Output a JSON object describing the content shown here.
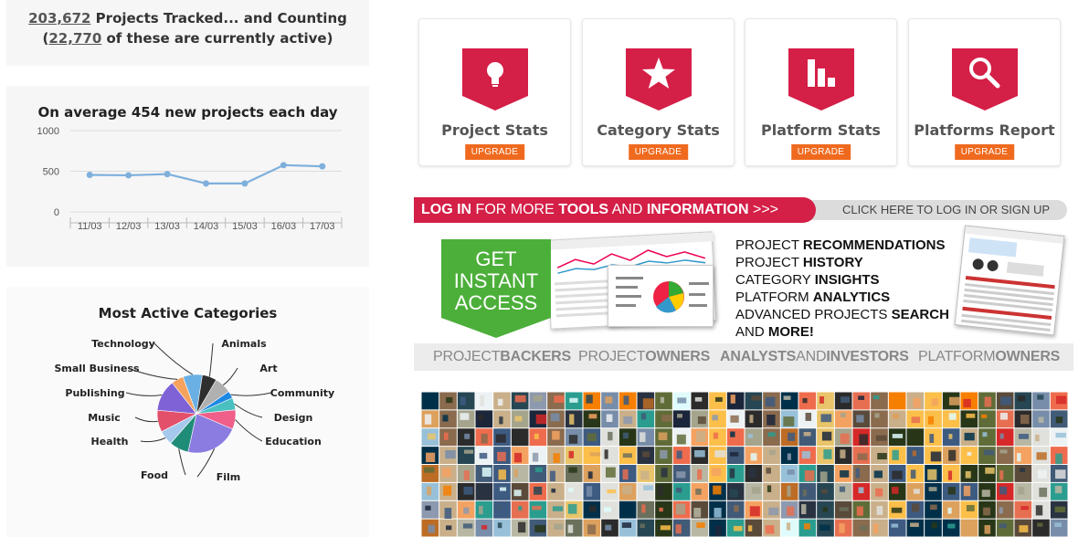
{
  "counter": {
    "tracked_count": "203,672",
    "tracked_text": " Projects Tracked... and Counting",
    "open_paren": "(",
    "active_count": "22,770",
    "active_text": " of these are currently active)"
  },
  "daily": {
    "title": "On average 454 new projects each day"
  },
  "categories_panel": {
    "title": "Most Active Categories"
  },
  "chart_data": [
    {
      "type": "line",
      "title": "On average 454 new projects each day",
      "x": [
        "11/03",
        "12/03",
        "13/03",
        "14/03",
        "15/03",
        "16/03",
        "17/03"
      ],
      "series": [
        {
          "values": [
            455,
            450,
            465,
            350,
            350,
            575,
            560
          ]
        }
      ],
      "yticks": [
        0,
        500,
        1000
      ],
      "ylim": [
        0,
        1000
      ],
      "grid": true,
      "color": "#7fb0dc"
    },
    {
      "type": "pie",
      "title": "Most Active Categories",
      "categories": [
        "Technology",
        "Animals",
        "Art",
        "Community",
        "Design",
        "Education",
        "Film",
        "Food",
        "Health",
        "Music",
        "Publishing",
        "Small Business"
      ],
      "values": [
        8,
        6,
        7,
        3,
        5,
        8,
        22,
        8,
        6,
        9,
        13,
        5
      ],
      "colors": [
        "#6ab0e4",
        "#2e2e2e",
        "#b0b0b0",
        "#1e88e5",
        "#4bc0c0",
        "#ef5f8a",
        "#8a7ce0",
        "#1f8c77",
        "#a5c8ec",
        "#e2506a",
        "#7e62d6",
        "#f5a25d"
      ]
    }
  ],
  "tools": [
    {
      "title": "Project Stats",
      "cta": "UPGRADE",
      "icon": "lightbulb-icon"
    },
    {
      "title": "Category Stats",
      "cta": "UPGRADE",
      "icon": "star-icon"
    },
    {
      "title": "Platform Stats",
      "cta": "UPGRADE",
      "icon": "bar-chart-icon"
    },
    {
      "title": "Platforms Report",
      "cta": "UPGRADE",
      "icon": "magnifier-icon"
    }
  ],
  "login": {
    "w1": "LOG IN",
    "w2": " FOR MORE ",
    "w3": "TOOLS",
    "w4": " AND ",
    "w5": "INFORMATION",
    "w6": " >>>",
    "cta": "CLICK HERE TO LOG IN OR SIGN UP"
  },
  "promo": {
    "line1": "GET",
    "line2": "INSTANT",
    "line3": "ACCESS",
    "features": [
      {
        "a": "PROJECT ",
        "b": "RECOMMENDATIONS",
        "c": ""
      },
      {
        "a": "PROJECT ",
        "b": "HISTORY",
        "c": ""
      },
      {
        "a": "CATEGORY ",
        "b": "INSIGHTS",
        "c": ""
      },
      {
        "a": "PLATFORM ",
        "b": "ANALYTICS",
        "c": ""
      },
      {
        "a": "ADVANCED PROJECTS ",
        "b": "SEARCH",
        "c": ""
      },
      {
        "a": "AND ",
        "b": "MORE!",
        "c": ""
      }
    ]
  },
  "audience": [
    {
      "a": "PROJECT",
      "b": "BACKERS",
      "c": "",
      "d": ""
    },
    {
      "a": "PROJECT",
      "b": "OWNERS",
      "c": "",
      "d": ""
    },
    {
      "a": "",
      "b": "ANALYSTS",
      "c": "AND",
      "d": "INVESTORS"
    },
    {
      "a": "PLATFORM",
      "b": "OWNERS",
      "c": "",
      "d": ""
    }
  ],
  "colors": {
    "brand_red": "#d41f47",
    "upgrade_orange": "#ef6a1f",
    "promo_green": "#4caf3a"
  }
}
